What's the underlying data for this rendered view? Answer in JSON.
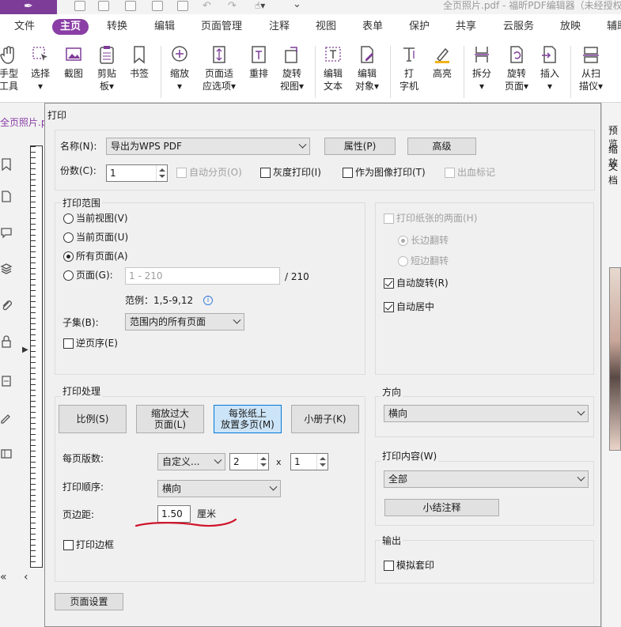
{
  "app": {
    "title": "全页照片.pdf - 福昕PDF编辑器（未经授权"
  },
  "menu": [
    {
      "label": "文件",
      "active": false
    },
    {
      "label": "主页",
      "active": true
    },
    {
      "label": "转换",
      "active": false
    },
    {
      "label": "编辑",
      "active": false
    },
    {
      "label": "页面管理",
      "active": false
    },
    {
      "label": "注释",
      "active": false
    },
    {
      "label": "视图",
      "active": false
    },
    {
      "label": "表单",
      "active": false
    },
    {
      "label": "保护",
      "active": false
    },
    {
      "label": "共享",
      "active": false
    },
    {
      "label": "云服务",
      "active": false
    },
    {
      "label": "放映",
      "active": false
    },
    {
      "label": "辅助",
      "active": false
    }
  ],
  "ribbon": {
    "hand": {
      "l1": "手型",
      "l2": "工具"
    },
    "select": {
      "l1": "选择",
      "l2": "▾"
    },
    "screenshot": {
      "l1": "截图"
    },
    "clipboard": {
      "l1": "剪贴",
      "l2": "板▾"
    },
    "bookmark": {
      "l1": "书签"
    },
    "zoom": {
      "l1": "缩放",
      "l2": "▾"
    },
    "fit_page": {
      "l1": "页面适",
      "l2": "应选项▾"
    },
    "reflow": {
      "l1": "重排"
    },
    "rotate_view": {
      "l1": "旋转",
      "l2": "视图▾"
    },
    "edit_text": {
      "l1": "编辑",
      "l2": "文本"
    },
    "edit_object": {
      "l1": "编辑",
      "l2": "对象▾"
    },
    "typewriter": {
      "l1": "打",
      "l2": "字机"
    },
    "highlight": {
      "l1": "高亮"
    },
    "split": {
      "l1": "拆分",
      "l2": "▾"
    },
    "rotate_page": {
      "l1": "旋转",
      "l2": "页面▾"
    },
    "insert": {
      "l1": "插入",
      "l2": "▾"
    },
    "from_scanner": {
      "l1": "从扫",
      "l2": "描仪▾"
    }
  },
  "file_tab": "全页照片.p",
  "preview_panel": {
    "title": "预览",
    "zoom": "缩放",
    "doc": "文档"
  },
  "dialog": {
    "title": "打印",
    "printer_label": "名称(N):",
    "printer_value": "导出为WPS PDF",
    "properties_btn": "属性(P)",
    "advanced_btn": "高级",
    "copies_label": "份数(C):",
    "copies_value": "1",
    "collate": "自动分页(O)",
    "grayscale": "灰度打印(I)",
    "as_image": "作为图像打印(T)",
    "bleed_marks": "出血标记",
    "range": {
      "title": "打印范围",
      "current_view": "当前视图(V)",
      "current_page": "当前页面(U)",
      "all_pages": "所有页面(A)",
      "pages": "页面(G):",
      "pages_placeholder": "1 - 210",
      "total": "/ 210",
      "example": "范例：1,5-9,12",
      "subset_label": "子集(B):",
      "subset_value": "范围内的所有页面",
      "reverse": "逆页序(E)"
    },
    "duplex": {
      "both_sides": "打印纸张的两面(H)",
      "long_edge": "长边翻转",
      "short_edge": "短边翻转",
      "auto_rotate": "自动旋转(R)",
      "auto_center": "自动居中"
    },
    "handling": {
      "title": "打印处理",
      "scale_btn": "比例(S)",
      "shrink_l1": "缩放过大",
      "shrink_l2": "页面(L)",
      "multi_l1": "每张纸上",
      "multi_l2": "放置多页(M)",
      "booklet_btn": "小册子(K)",
      "pages_per_sheet_label": "每页版数:",
      "pages_per_sheet_value": "自定义...",
      "cols_value": "2",
      "times": "x",
      "rows_value": "1",
      "order_label": "打印顺序:",
      "order_value": "横向",
      "margin_label": "页边距:",
      "margin_value": "1.50",
      "margin_unit": "厘米",
      "border": "打印边框"
    },
    "orientation": {
      "title": "方向",
      "value": "横向"
    },
    "content": {
      "title": "打印内容(W)",
      "value": "全部",
      "summary_btn": "小结注释"
    },
    "output": {
      "title": "输出",
      "simulate": "模拟套印"
    },
    "page_setup_btn": "页面设置"
  },
  "colors": {
    "accent": "#8a3ea5",
    "annotation": "#d0142c"
  }
}
